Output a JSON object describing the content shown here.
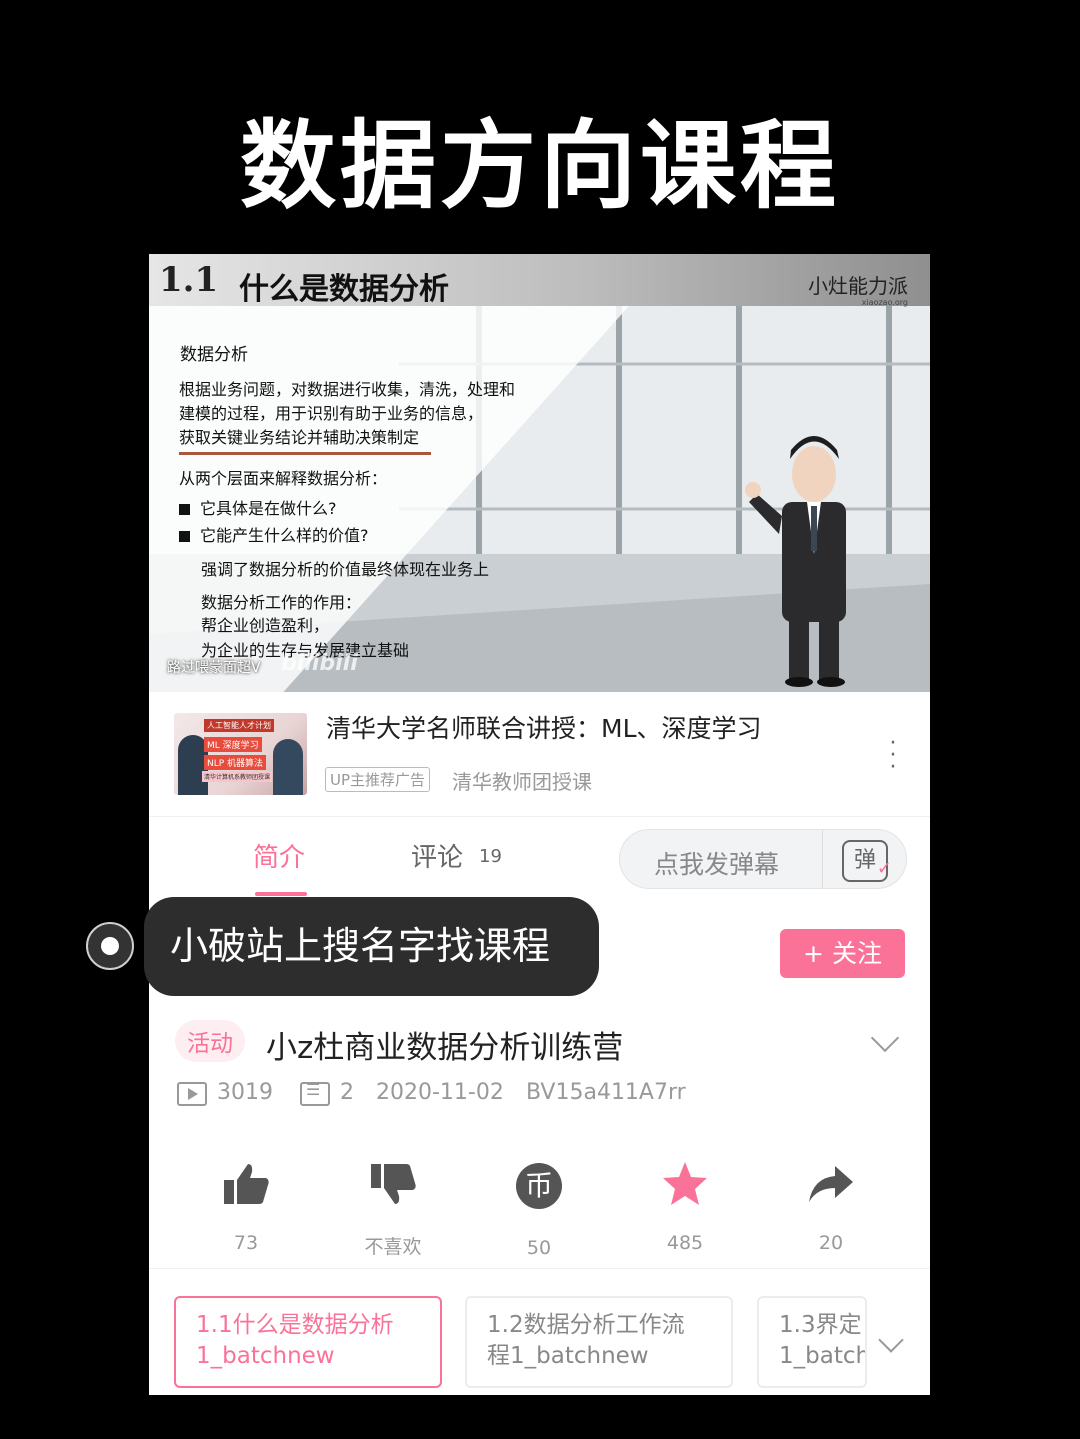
{
  "page_title": "数据方向课程",
  "video": {
    "slide_number": "1.1",
    "slide_title": "什么是数据分析",
    "brand": "小灶能力派",
    "brand_sub": "xiaozao.org",
    "heading": "数据分析",
    "definition_lines": [
      "根据业务问题，对数据进行收集，清洗，处理和",
      "建模的过程，用于识别有助于业务的信息，",
      "获取关键业务结论并辅助决策制定"
    ],
    "explain_intro": "从两个层面来解释数据分析：",
    "bullets": [
      "它具体是在做什么?",
      "它能产生什么样的价值?"
    ],
    "emphasis": "强调了数据分析的价值最终体现在业务上",
    "role_title": "数据分析工作的作用：",
    "role_lines": [
      "帮企业创造盈利，",
      "为企业的生存与发展建立基础"
    ],
    "watermark": "路过喂蒙面超V",
    "platform_mark": "bilibili"
  },
  "ad": {
    "thumb_lines": [
      "人工智能人才计划",
      "ML  深度学习",
      "NLP 机器算法",
      "清华计算机系教师团授课"
    ],
    "title": "清华大学名师联合讲授：ML、深度学习",
    "tag": "UP主推荐广告",
    "subtitle": "清华教师团授课"
  },
  "tabs": {
    "intro": "简介",
    "comments": "评论",
    "comment_count": "19",
    "danmu_placeholder": "点我发弹幕",
    "danmu_icon_char": "弹"
  },
  "annotation": "小破站上搜名字找课程",
  "follow_label": "+ 关注",
  "info": {
    "activity_tag": "活动",
    "title": "小z杜商业数据分析训练营",
    "plays": "3019",
    "danmaku": "2",
    "date": "2020-11-02",
    "bvid": "BV15a411A7rr"
  },
  "actions": [
    {
      "name": "like",
      "icon": "thumbs-up",
      "label": "73"
    },
    {
      "name": "dislike",
      "icon": "thumbs-down",
      "label": "不喜欢"
    },
    {
      "name": "coin",
      "icon": "coin",
      "label": "50"
    },
    {
      "name": "favorite",
      "icon": "star",
      "label": "485"
    },
    {
      "name": "share",
      "icon": "share-arrow",
      "label": "20"
    }
  ],
  "episodes": [
    {
      "line1": "1.1什么是数据分析",
      "line2": "1_batchnew",
      "active": true
    },
    {
      "line1": "1.2数据分析工作流",
      "line2": "程1_batchnew",
      "active": false
    },
    {
      "line1": "1.3界定",
      "line2": "1_batch",
      "active": false
    }
  ],
  "colors": {
    "accent": "#fb7299",
    "background": "#000000"
  }
}
